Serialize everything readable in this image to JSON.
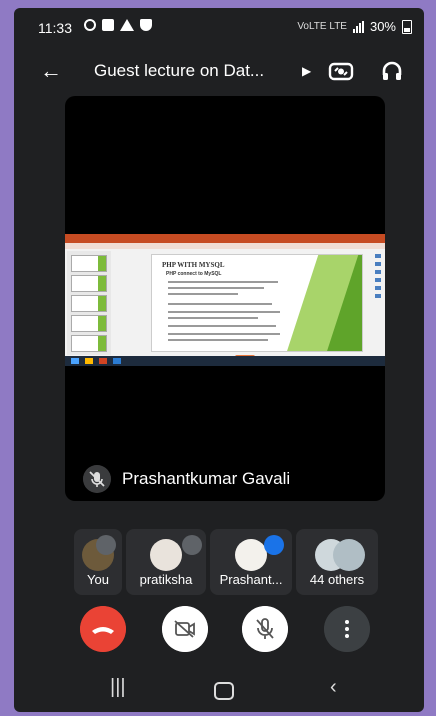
{
  "status_bar": {
    "time": "11:33",
    "network_label": "VoLTE LTE",
    "battery": "30%"
  },
  "app_bar": {
    "title": "Guest lecture on Dat..."
  },
  "main_tile": {
    "presenter_name": "Prashantkumar Gavali",
    "slide": {
      "heading": "PHP WITH MYSQL",
      "subheading": "PHP connect to MySQL"
    }
  },
  "participants": [
    {
      "label": "You",
      "muted": true
    },
    {
      "label": "pratiksha",
      "muted": true
    },
    {
      "label": "Prashant...",
      "speaking": true
    },
    {
      "label": "44 others"
    }
  ],
  "controls": [
    "end-call",
    "camera-off",
    "mic-off",
    "more-options"
  ],
  "colors": {
    "end_call": "#ea4335",
    "speaking": "#1a73e8",
    "slide_accent": "#7dbb3a"
  }
}
